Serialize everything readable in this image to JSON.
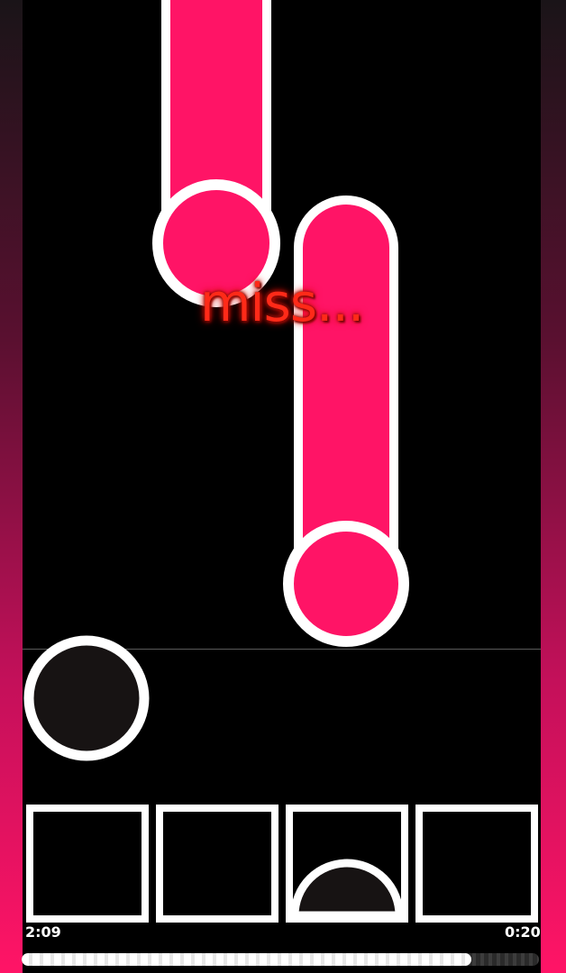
{
  "judgement": {
    "text": "miss..."
  },
  "time": {
    "elapsed": "2:09",
    "remaining": "0:20"
  },
  "progress": {
    "fraction": 0.87
  },
  "lanes": {
    "count": 4,
    "pressed_lane_index": 2
  },
  "colors": {
    "note_fill": "#ff1466",
    "note_outline": "#ffffff",
    "background": "#000000",
    "miss_text": "#ff2a18",
    "side_bar_gradient_top": "#1a1418",
    "side_bar_gradient_bottom": "#ff1466"
  },
  "icons": {
    "hold_note_1": "hold-note-icon",
    "hold_note_2": "hold-note-icon",
    "touch_cursor": "touch-cursor-icon"
  }
}
